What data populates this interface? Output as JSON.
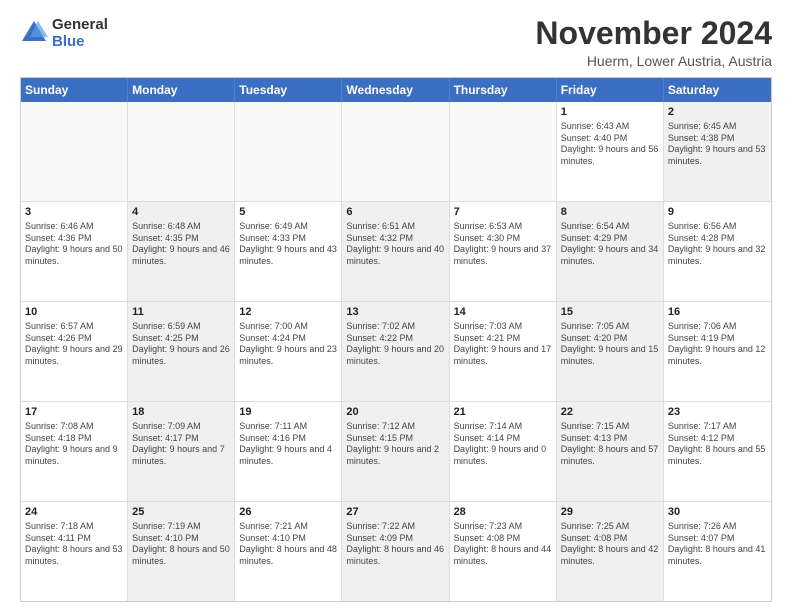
{
  "logo": {
    "line1": "General",
    "line2": "Blue"
  },
  "title": "November 2024",
  "subtitle": "Huerm, Lower Austria, Austria",
  "headers": [
    "Sunday",
    "Monday",
    "Tuesday",
    "Wednesday",
    "Thursday",
    "Friday",
    "Saturday"
  ],
  "rows": [
    [
      {
        "day": "",
        "text": "",
        "shaded": false,
        "empty": true
      },
      {
        "day": "",
        "text": "",
        "shaded": false,
        "empty": true
      },
      {
        "day": "",
        "text": "",
        "shaded": false,
        "empty": true
      },
      {
        "day": "",
        "text": "",
        "shaded": false,
        "empty": true
      },
      {
        "day": "",
        "text": "",
        "shaded": false,
        "empty": true
      },
      {
        "day": "1",
        "text": "Sunrise: 6:43 AM\nSunset: 4:40 PM\nDaylight: 9 hours and 56 minutes.",
        "shaded": false,
        "empty": false
      },
      {
        "day": "2",
        "text": "Sunrise: 6:45 AM\nSunset: 4:38 PM\nDaylight: 9 hours and 53 minutes.",
        "shaded": true,
        "empty": false
      }
    ],
    [
      {
        "day": "3",
        "text": "Sunrise: 6:46 AM\nSunset: 4:36 PM\nDaylight: 9 hours and 50 minutes.",
        "shaded": false,
        "empty": false
      },
      {
        "day": "4",
        "text": "Sunrise: 6:48 AM\nSunset: 4:35 PM\nDaylight: 9 hours and 46 minutes.",
        "shaded": true,
        "empty": false
      },
      {
        "day": "5",
        "text": "Sunrise: 6:49 AM\nSunset: 4:33 PM\nDaylight: 9 hours and 43 minutes.",
        "shaded": false,
        "empty": false
      },
      {
        "day": "6",
        "text": "Sunrise: 6:51 AM\nSunset: 4:32 PM\nDaylight: 9 hours and 40 minutes.",
        "shaded": true,
        "empty": false
      },
      {
        "day": "7",
        "text": "Sunrise: 6:53 AM\nSunset: 4:30 PM\nDaylight: 9 hours and 37 minutes.",
        "shaded": false,
        "empty": false
      },
      {
        "day": "8",
        "text": "Sunrise: 6:54 AM\nSunset: 4:29 PM\nDaylight: 9 hours and 34 minutes.",
        "shaded": true,
        "empty": false
      },
      {
        "day": "9",
        "text": "Sunrise: 6:56 AM\nSunset: 4:28 PM\nDaylight: 9 hours and 32 minutes.",
        "shaded": false,
        "empty": false
      }
    ],
    [
      {
        "day": "10",
        "text": "Sunrise: 6:57 AM\nSunset: 4:26 PM\nDaylight: 9 hours and 29 minutes.",
        "shaded": false,
        "empty": false
      },
      {
        "day": "11",
        "text": "Sunrise: 6:59 AM\nSunset: 4:25 PM\nDaylight: 9 hours and 26 minutes.",
        "shaded": true,
        "empty": false
      },
      {
        "day": "12",
        "text": "Sunrise: 7:00 AM\nSunset: 4:24 PM\nDaylight: 9 hours and 23 minutes.",
        "shaded": false,
        "empty": false
      },
      {
        "day": "13",
        "text": "Sunrise: 7:02 AM\nSunset: 4:22 PM\nDaylight: 9 hours and 20 minutes.",
        "shaded": true,
        "empty": false
      },
      {
        "day": "14",
        "text": "Sunrise: 7:03 AM\nSunset: 4:21 PM\nDaylight: 9 hours and 17 minutes.",
        "shaded": false,
        "empty": false
      },
      {
        "day": "15",
        "text": "Sunrise: 7:05 AM\nSunset: 4:20 PM\nDaylight: 9 hours and 15 minutes.",
        "shaded": true,
        "empty": false
      },
      {
        "day": "16",
        "text": "Sunrise: 7:06 AM\nSunset: 4:19 PM\nDaylight: 9 hours and 12 minutes.",
        "shaded": false,
        "empty": false
      }
    ],
    [
      {
        "day": "17",
        "text": "Sunrise: 7:08 AM\nSunset: 4:18 PM\nDaylight: 9 hours and 9 minutes.",
        "shaded": false,
        "empty": false
      },
      {
        "day": "18",
        "text": "Sunrise: 7:09 AM\nSunset: 4:17 PM\nDaylight: 9 hours and 7 minutes.",
        "shaded": true,
        "empty": false
      },
      {
        "day": "19",
        "text": "Sunrise: 7:11 AM\nSunset: 4:16 PM\nDaylight: 9 hours and 4 minutes.",
        "shaded": false,
        "empty": false
      },
      {
        "day": "20",
        "text": "Sunrise: 7:12 AM\nSunset: 4:15 PM\nDaylight: 9 hours and 2 minutes.",
        "shaded": true,
        "empty": false
      },
      {
        "day": "21",
        "text": "Sunrise: 7:14 AM\nSunset: 4:14 PM\nDaylight: 9 hours and 0 minutes.",
        "shaded": false,
        "empty": false
      },
      {
        "day": "22",
        "text": "Sunrise: 7:15 AM\nSunset: 4:13 PM\nDaylight: 8 hours and 57 minutes.",
        "shaded": true,
        "empty": false
      },
      {
        "day": "23",
        "text": "Sunrise: 7:17 AM\nSunset: 4:12 PM\nDaylight: 8 hours and 55 minutes.",
        "shaded": false,
        "empty": false
      }
    ],
    [
      {
        "day": "24",
        "text": "Sunrise: 7:18 AM\nSunset: 4:11 PM\nDaylight: 8 hours and 53 minutes.",
        "shaded": false,
        "empty": false
      },
      {
        "day": "25",
        "text": "Sunrise: 7:19 AM\nSunset: 4:10 PM\nDaylight: 8 hours and 50 minutes.",
        "shaded": true,
        "empty": false
      },
      {
        "day": "26",
        "text": "Sunrise: 7:21 AM\nSunset: 4:10 PM\nDaylight: 8 hours and 48 minutes.",
        "shaded": false,
        "empty": false
      },
      {
        "day": "27",
        "text": "Sunrise: 7:22 AM\nSunset: 4:09 PM\nDaylight: 8 hours and 46 minutes.",
        "shaded": true,
        "empty": false
      },
      {
        "day": "28",
        "text": "Sunrise: 7:23 AM\nSunset: 4:08 PM\nDaylight: 8 hours and 44 minutes.",
        "shaded": false,
        "empty": false
      },
      {
        "day": "29",
        "text": "Sunrise: 7:25 AM\nSunset: 4:08 PM\nDaylight: 8 hours and 42 minutes.",
        "shaded": true,
        "empty": false
      },
      {
        "day": "30",
        "text": "Sunrise: 7:26 AM\nSunset: 4:07 PM\nDaylight: 8 hours and 41 minutes.",
        "shaded": false,
        "empty": false
      }
    ]
  ]
}
